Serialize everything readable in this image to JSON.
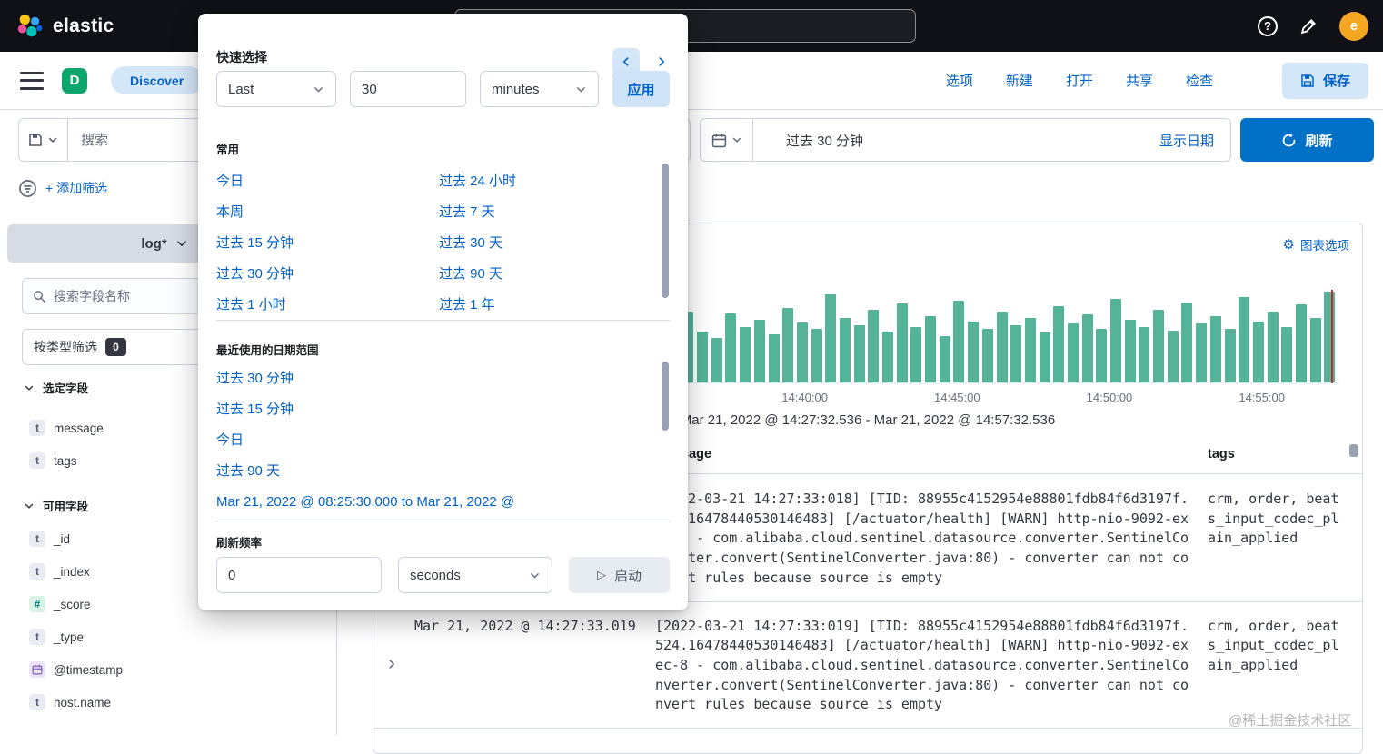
{
  "topbar": {
    "brand": "elastic",
    "avatar_initial": "e"
  },
  "appbar": {
    "space_initial": "D",
    "breadcrumb": "Discover",
    "menu": [
      "选项",
      "新建",
      "打开",
      "共享",
      "检查"
    ],
    "save_label": "保存"
  },
  "querybar": {
    "search_placeholder": "搜索",
    "date_display": "过去 30 分钟",
    "show_dates_label": "显示日期",
    "refresh_label": "刷新"
  },
  "filterbar": {
    "add_filter_label": "+ 添加筛选"
  },
  "sidebar": {
    "index_pattern": "log*",
    "field_search_placeholder": "搜索字段名称",
    "filter_by_type_label": "按类型筛选",
    "filter_by_type_count": "0",
    "selected_fields_title": "选定字段",
    "selected_fields": [
      {
        "type": "t",
        "name": "message"
      },
      {
        "type": "t",
        "name": "tags"
      }
    ],
    "available_fields_title": "可用字段",
    "available_fields": [
      {
        "type": "t",
        "name": "_id"
      },
      {
        "type": "t",
        "name": "_index"
      },
      {
        "type": "#",
        "name": "_score"
      },
      {
        "type": "t",
        "name": "_type"
      },
      {
        "type": "date",
        "name": "@timestamp"
      },
      {
        "type": "t",
        "name": "host.name"
      }
    ]
  },
  "timepicker": {
    "title": "快速选择",
    "quick_mode": "Last",
    "quick_value": "30",
    "quick_unit": "minutes",
    "apply_label": "应用",
    "commonly_used_title": "常用",
    "commonly_used_col1": [
      "今日",
      "本周",
      "过去 15 分钟",
      "过去 30 分钟",
      "过去 1 小时"
    ],
    "commonly_used_col2": [
      "过去 24 小时",
      "过去 7 天",
      "过去 30 天",
      "过去 90 天",
      "过去 1 年"
    ],
    "recent_title": "最近使用的日期范围",
    "recent_ranges": [
      "过去 30 分钟",
      "过去 15 分钟",
      "今日",
      "过去 90 天",
      "Mar 21, 2022 @ 08:25:30.000 to Mar 21, 2022 @"
    ],
    "refresh_title": "刷新频率",
    "refresh_value": "0",
    "refresh_unit": "seconds",
    "start_label": "启动"
  },
  "main": {
    "chart_options_label": "图表选项",
    "range_text": "Mar 21, 2022 @ 14:27:32.536 - Mar 21, 2022 @ 14:57:32.536",
    "table": {
      "message_header": "message",
      "tags_header": "tags",
      "rows": [
        {
          "time": "",
          "message": "[2022-03-21 14:27:33:018] [TID: 88955c4152954e88801fdb84f6d3197f.524.16478440530146483] [/actuator/health] [WARN] http-nio-9092-exec-8 - com.alibaba.cloud.sentinel.datasource.converter.SentinelConverter.convert(SentinelConverter.java:80) - converter can not convert rules because source is empty",
          "tags": "crm, order, beats_input_codec_plain_applied"
        },
        {
          "time": "Mar 21, 2022 @ 14:27:33.019",
          "message": "[2022-03-21 14:27:33:019] [TID: 88955c4152954e88801fdb84f6d3197f.524.16478440530146483] [/actuator/health] [WARN] http-nio-9092-exec-8 - com.alibaba.cloud.sentinel.datasource.converter.SentinelConverter.convert(SentinelConverter.java:80) - converter can not convert rules because source is empty",
          "tags": "crm, order, beats_input_codec_plain_applied"
        }
      ]
    }
  },
  "watermark": "@稀土掘金技术社区",
  "chart_data": {
    "type": "bar",
    "title": "",
    "xlabel": "",
    "ylabel": "",
    "x_tick_labels": [
      "14:40:00",
      "14:45:00",
      "14:50:00",
      "14:55:00"
    ],
    "x_tick_positions_pct": [
      41.5,
      58.2,
      74.9,
      91.6
    ],
    "time_range": "Mar 21, 2022 @ 14:27:32.536 - Mar 21, 2022 @ 14:57:32.536",
    "bar_color": "#54b399",
    "current_time_marker_color": "#bf2e2e",
    "values": [
      60,
      72,
      55,
      68,
      80,
      58,
      70,
      62,
      75,
      52,
      66,
      78,
      56,
      84,
      60,
      72,
      64,
      58,
      76,
      55,
      48,
      75,
      60,
      68,
      52,
      80,
      65,
      58,
      95,
      70,
      62,
      78,
      55,
      85,
      60,
      72,
      50,
      88,
      66,
      58,
      76,
      62,
      70,
      54,
      82,
      64,
      74,
      58,
      90,
      68,
      60,
      78,
      56,
      86,
      64,
      72,
      58,
      92,
      66,
      76,
      60,
      84,
      70,
      98
    ]
  }
}
